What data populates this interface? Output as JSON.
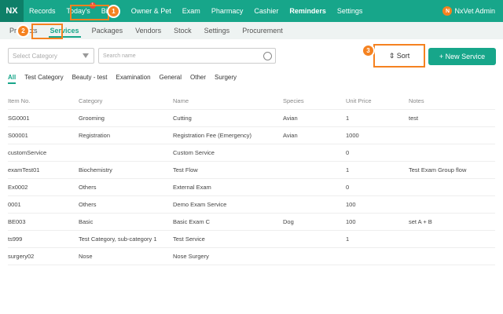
{
  "nav": {
    "logo": "NX",
    "items": [
      "Records",
      "Today's",
      "Billing",
      "Owner & Pet",
      "Exam",
      "Pharmacy",
      "Cashier",
      "Reminders",
      "Settings"
    ],
    "todays_badge": "1",
    "user_initial": "N",
    "user_name": "NxVet Admin"
  },
  "subnav": {
    "items": [
      "Products",
      "Services",
      "Packages",
      "Vendors",
      "Stock",
      "Settings",
      "Procurement"
    ]
  },
  "filters": {
    "category_placeholder": "Select Category",
    "search_placeholder": "Search name"
  },
  "buttons": {
    "sort": "⇕ Sort",
    "new_service": "+ New Service"
  },
  "categories": [
    "All",
    "Test Category",
    "Beauty - test",
    "Examination",
    "General",
    "Other",
    "Surgery"
  ],
  "table": {
    "headers": [
      "Item No.",
      "Category",
      "Name",
      "Species",
      "Unit Price",
      "Notes"
    ],
    "rows": [
      [
        "SG0001",
        "Grooming",
        "Cutting",
        "Avian",
        "1",
        "test"
      ],
      [
        "S00001",
        "Registration",
        "Registration Fee (Emergency)",
        "Avian",
        "1000",
        ""
      ],
      [
        "customService",
        "",
        "Custom Service",
        "",
        "0",
        ""
      ],
      [
        "examTest01",
        "Biochemistry",
        "Test Flow",
        "",
        "1",
        "Test Exam Group flow"
      ],
      [
        "Ex0002",
        "Others",
        "External Exam",
        "",
        "0",
        ""
      ],
      [
        "0001",
        "Others",
        "Demo Exam Service",
        "",
        "100",
        ""
      ],
      [
        "BE003",
        "Basic",
        "Basic Exam C",
        "Dog",
        "100",
        "set A + B"
      ],
      [
        "ts999",
        "Test Category, sub-category 1",
        "Test Service",
        "",
        "1",
        ""
      ],
      [
        "surgery02",
        "Nose",
        "Nose Surgery",
        "",
        "",
        ""
      ]
    ]
  },
  "annotations": [
    "1",
    "2",
    "3"
  ],
  "colors": {
    "primary": "#17a68a",
    "annotation": "#f58220"
  }
}
